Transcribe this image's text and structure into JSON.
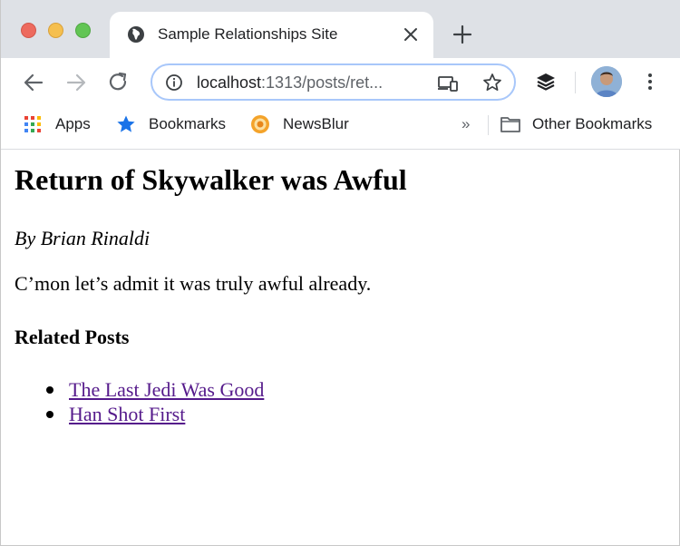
{
  "browser": {
    "tab_title": "Sample Relationships Site",
    "url_host": "localhost",
    "url_path": ":1313/posts/ret..."
  },
  "bookmarks_bar": {
    "items": [
      {
        "label": "Apps",
        "icon": "apps-grid-icon"
      },
      {
        "label": "Bookmarks",
        "icon": "star-icon"
      },
      {
        "label": "NewsBlur",
        "icon": "newsblur-icon"
      }
    ],
    "overflow": "»",
    "other": {
      "label": "Other Bookmarks",
      "icon": "folder-icon"
    }
  },
  "page": {
    "title": "Return of Skywalker was Awful",
    "byline": "By Brian Rinaldi",
    "body": "C’mon let’s admit it was truly awful already.",
    "related_heading": "Related Posts",
    "related": [
      {
        "label": "The Last Jedi Was Good"
      },
      {
        "label": "Han Shot First"
      }
    ]
  },
  "colors": {
    "tabstrip": "#dee1e6",
    "omnibox_focus": "#a8c7fa",
    "visited_link": "#551a8b"
  }
}
